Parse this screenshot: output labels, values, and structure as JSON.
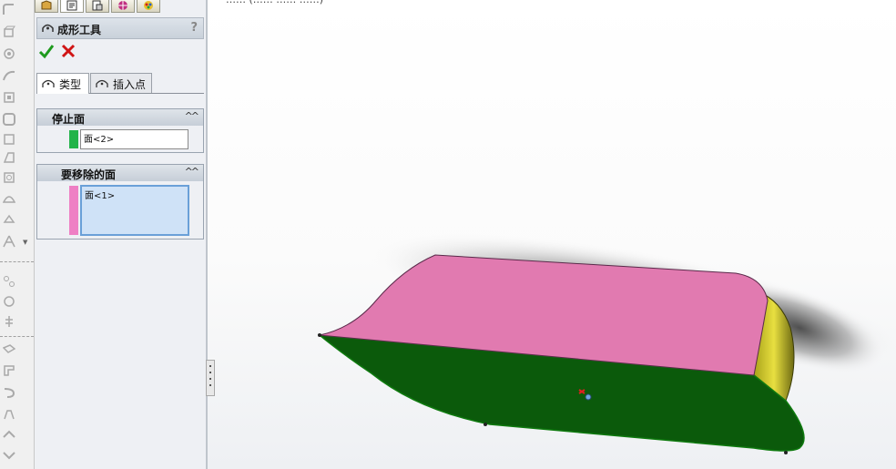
{
  "toolbar": {
    "icons": [
      "fillet-icon",
      "extrude-icon",
      "revolve-icon",
      "sweep-icon",
      "loft-icon",
      "shell-icon",
      "rib-icon",
      "draft-icon",
      "hole-icon",
      "dome-icon",
      "wrap-icon",
      "mirror-icon",
      "pattern-icon",
      "curves-icon",
      "reference-geometry-icon",
      "sheet-metal-icon",
      "flange-icon",
      "hem-icon",
      "forming-tool-icon",
      "unfold-icon"
    ]
  },
  "tabs": {
    "icons": [
      "feature-manager-icon",
      "property-manager-icon",
      "configuration-manager-icon",
      "dimxpert-icon",
      "display-manager-icon"
    ]
  },
  "property_manager": {
    "title": "成形工具",
    "help_label": "?",
    "subtabs": [
      {
        "label": "类型",
        "active": true
      },
      {
        "label": "插入点",
        "active": false
      }
    ],
    "stop_face": {
      "header": "停止面",
      "value": "面<2>",
      "swatch_color": "#22b34a"
    },
    "faces_to_remove": {
      "header": "要移除的面",
      "value": "面<1>",
      "swatch_color": "#ee7fc4"
    }
  },
  "viewport": {
    "top_label": "…… (…… …… ……)",
    "model": {
      "top_face_color": "#e17ab0",
      "side_face_color": "#0b5a0b",
      "end_face_color": "#c9c020"
    }
  }
}
